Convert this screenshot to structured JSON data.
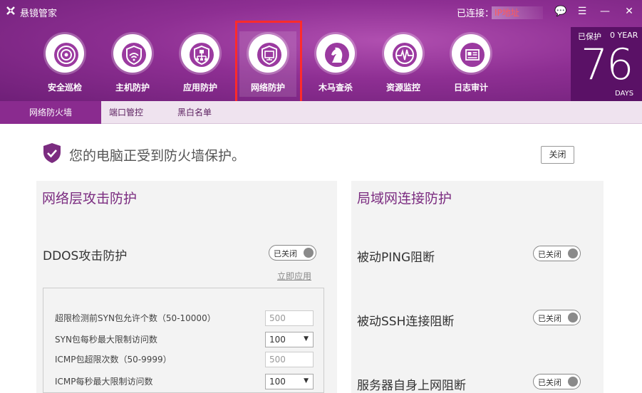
{
  "app": {
    "title": "悬镜管家"
  },
  "titlebar": {
    "connection_label": "已连接：",
    "connection_value": "IP地址"
  },
  "window_buttons": {
    "message": "💬",
    "menu": "☰",
    "minimize": "—",
    "close": "✕"
  },
  "nav": {
    "items": [
      {
        "label": "安全巡检",
        "icon": "scan-target-icon"
      },
      {
        "label": "主机防护",
        "icon": "host-shield-icon"
      },
      {
        "label": "应用防护",
        "icon": "app-shield-icon"
      },
      {
        "label": "网络防护",
        "icon": "network-shield-icon",
        "active": true
      },
      {
        "label": "木马查杀",
        "icon": "knight-icon"
      },
      {
        "label": "资源监控",
        "icon": "pulse-icon"
      },
      {
        "label": "日志审计",
        "icon": "log-icon"
      }
    ]
  },
  "stats": {
    "protected_label": "已保护",
    "year_label": "0 YEAR",
    "days": "76",
    "days_unit": "DAYS"
  },
  "subtabs": [
    {
      "label": "网络防火墙",
      "active": true
    },
    {
      "label": "端口管控"
    },
    {
      "label": "黑白名单"
    }
  ],
  "banner": {
    "text": "您的电脑正受到防火墙保护。",
    "close_label": "关闭"
  },
  "left_panel": {
    "title": "网络层攻击防护",
    "ddos": {
      "label": "DDOS攻击防护",
      "toggle": "已关闭",
      "apply_link": "立即应用"
    },
    "settings": [
      {
        "label": "超限检测前SYN包允许个数（50-10000）",
        "type": "input",
        "value": "500"
      },
      {
        "label": "SYN包每秒最大限制访问数",
        "type": "select",
        "value": "100"
      },
      {
        "label": "ICMP包超限次数（50-9999）",
        "type": "input",
        "value": "500"
      },
      {
        "label": "ICMP每秒最大限制访问数",
        "type": "select",
        "value": "100"
      }
    ]
  },
  "right_panel": {
    "title": "局域网连接防护",
    "rows": [
      {
        "label": "被动PING阻断",
        "toggle": "已关闭"
      },
      {
        "label": "被动SSH连接阻断",
        "toggle": "已关闭"
      },
      {
        "label": "服务器自身上网阻断",
        "toggle": "已关闭"
      }
    ]
  },
  "colors": {
    "brand": "#8e2f93",
    "highlight": "#ff2b2b",
    "title_text": "#7b2c80"
  }
}
